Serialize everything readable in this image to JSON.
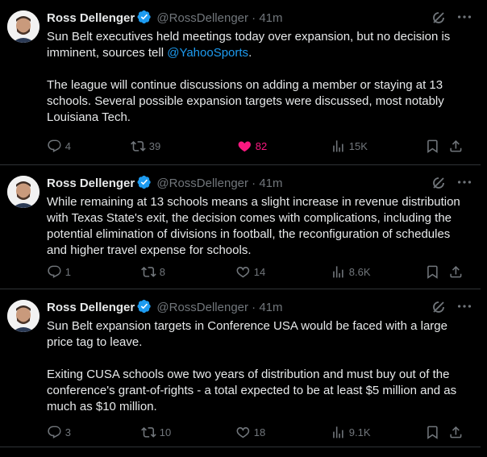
{
  "tweets": [
    {
      "author": "Ross Dellenger",
      "handle": "@RossDellenger",
      "separator": "·",
      "time": "41m",
      "paragraphs": [
        {
          "text_before": "Sun Belt executives held meetings today over expansion, but no decision is imminent, sources tell ",
          "mention": "@YahooSports",
          "text_after": "."
        },
        {
          "text_before": "The league will continue discussions on adding a member or staying at 13 schools. Several possible expansion targets were discussed, most notably Louisiana Tech.",
          "mention": "",
          "text_after": ""
        }
      ],
      "stats": {
        "replies": "4",
        "reposts": "39",
        "likes": "82",
        "views": "15K"
      },
      "liked": true
    },
    {
      "author": "Ross Dellenger",
      "handle": "@RossDellenger",
      "separator": "·",
      "time": "41m",
      "paragraphs": [
        {
          "text_before": "While remaining at 13 schools means a slight increase in revenue distribution with Texas State's exit, the decision comes with complications, including the potential elimination of divisions in football, the reconfiguration of schedules and higher travel expense for schools.",
          "mention": "",
          "text_after": ""
        }
      ],
      "stats": {
        "replies": "1",
        "reposts": "8",
        "likes": "14",
        "views": "8.6K"
      },
      "liked": false
    },
    {
      "author": "Ross Dellenger",
      "handle": "@RossDellenger",
      "separator": "·",
      "time": "41m",
      "paragraphs": [
        {
          "text_before": "Sun Belt expansion targets in Conference USA would be faced with a large price tag to leave.",
          "mention": "",
          "text_after": ""
        },
        {
          "text_before": "Exiting CUSA schools owe two years of distribution and must buy out of the conference's grant-of-rights - a total expected to be at least $5 million and as much as $10 million.",
          "mention": "",
          "text_after": ""
        }
      ],
      "stats": {
        "replies": "3",
        "reposts": "10",
        "likes": "18",
        "views": "9.1K"
      },
      "liked": false
    }
  ],
  "icons": {
    "verified": "verified-badge-icon",
    "grok": "grok-icon",
    "more": "more-icon",
    "reply": "reply-icon",
    "repost": "repost-icon",
    "like": "heart-icon",
    "views": "views-icon",
    "bookmark": "bookmark-icon",
    "share": "share-icon"
  },
  "colors": {
    "background": "#000000",
    "text": "#e7e9ea",
    "secondary": "#71767b",
    "link": "#1d9bf0",
    "like": "#f91880",
    "verified": "#1d9bf0",
    "border": "#2f3336"
  }
}
